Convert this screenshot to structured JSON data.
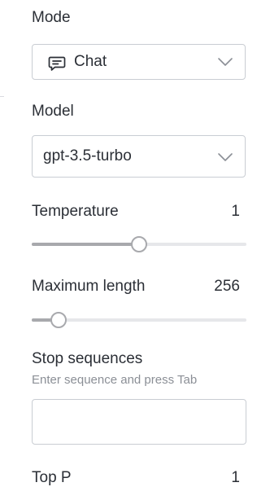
{
  "mode": {
    "label": "Mode",
    "selected": "Chat",
    "icon": "chat-bubble-icon"
  },
  "model": {
    "label": "Model",
    "selected": "gpt-3.5-turbo"
  },
  "temperature": {
    "label": "Temperature",
    "value": "1",
    "fraction": 0.5
  },
  "maximum_length": {
    "label": "Maximum length",
    "value": "256",
    "fraction": 0.125
  },
  "stop_sequences": {
    "label": "Stop sequences",
    "hint": "Enter sequence and press Tab",
    "value": ""
  },
  "top_p": {
    "label": "Top P",
    "value": "1"
  },
  "colors": {
    "border": "#c9cdd3",
    "slider_fill": "#a8a9ad",
    "slider_track": "#e6e7ea",
    "text": "#2b2f36",
    "hint": "#8b8f96"
  }
}
